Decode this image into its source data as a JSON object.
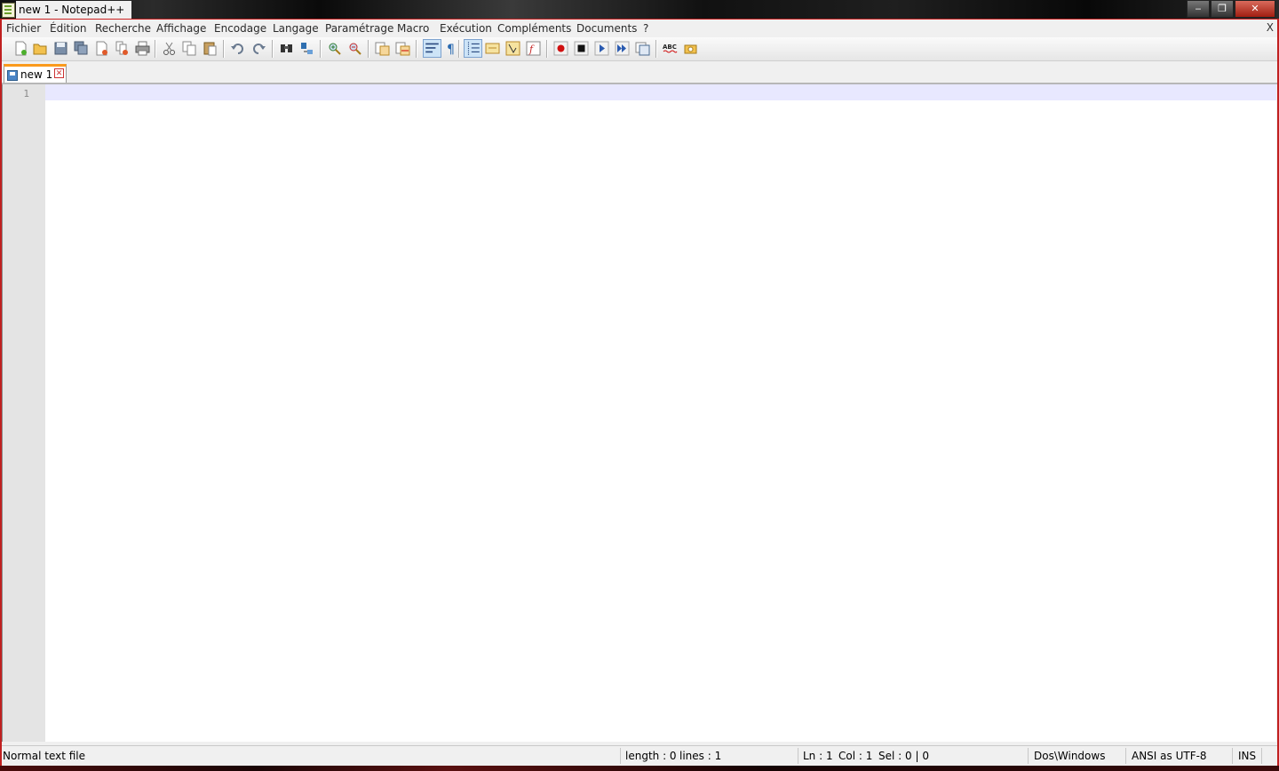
{
  "window": {
    "title": "new  1 - Notepad++",
    "controls": {
      "minimize": "‒",
      "maximize": "❐",
      "close": "✕"
    }
  },
  "menu": {
    "items": [
      "Fichier",
      "Édition",
      "Recherche",
      "Affichage",
      "Encodage",
      "Langage",
      "Paramétrage",
      "Macro",
      "Exécution",
      "Compléments",
      "Documents",
      "?"
    ],
    "close_label": "X"
  },
  "toolbar": {
    "buttons": [
      {
        "name": "new-file",
        "icon": "new-file-icon"
      },
      {
        "name": "open-file",
        "icon": "folder-open-icon"
      },
      {
        "name": "save",
        "icon": "save-icon"
      },
      {
        "name": "save-all",
        "icon": "save-all-icon"
      },
      {
        "name": "close",
        "icon": "close-file-icon"
      },
      {
        "name": "close-all",
        "icon": "close-all-icon"
      },
      {
        "name": "print",
        "icon": "print-icon"
      },
      {
        "name": "cut",
        "icon": "scissors-icon"
      },
      {
        "name": "copy",
        "icon": "copy-icon"
      },
      {
        "name": "paste",
        "icon": "paste-icon"
      },
      {
        "name": "undo",
        "icon": "undo-icon"
      },
      {
        "name": "redo",
        "icon": "redo-icon"
      },
      {
        "name": "find",
        "icon": "binoculars-icon"
      },
      {
        "name": "replace",
        "icon": "replace-icon"
      },
      {
        "name": "zoom-in",
        "icon": "zoom-in-icon"
      },
      {
        "name": "zoom-out",
        "icon": "zoom-out-icon"
      },
      {
        "name": "sync-vertical",
        "icon": "sync-vertical-icon"
      },
      {
        "name": "sync-horizontal",
        "icon": "sync-horizontal-icon"
      },
      {
        "name": "word-wrap",
        "icon": "word-wrap-icon"
      },
      {
        "name": "show-all-chars",
        "icon": "pilcrow-icon"
      },
      {
        "name": "indent-guide",
        "icon": "indent-guide-icon"
      },
      {
        "name": "user-defined-language",
        "icon": "udl-icon"
      },
      {
        "name": "document-map",
        "icon": "document-map-icon"
      },
      {
        "name": "function-list",
        "icon": "function-list-icon"
      },
      {
        "name": "macro-record",
        "icon": "record-icon"
      },
      {
        "name": "macro-stop",
        "icon": "stop-icon"
      },
      {
        "name": "macro-play",
        "icon": "play-icon"
      },
      {
        "name": "macro-run-multiple",
        "icon": "fast-forward-icon"
      },
      {
        "name": "macro-save",
        "icon": "save-macro-icon"
      },
      {
        "name": "spell-check",
        "icon": "spellcheck-icon"
      },
      {
        "name": "plugin",
        "icon": "plugin-icon"
      }
    ],
    "active": [
      "word-wrap",
      "indent-guide"
    ]
  },
  "tabs": [
    {
      "label": "new  1",
      "close": "✕"
    }
  ],
  "editor": {
    "line_numbers": [
      "1"
    ],
    "content": ""
  },
  "statusbar": {
    "file_type": "Normal text file",
    "length": "length : 0",
    "lines": "lines : 1",
    "ln": "Ln : 1",
    "col": "Col : 1",
    "sel": "Sel : 0 | 0",
    "eol": "Dos\\Windows",
    "encoding": "ANSI as UTF-8",
    "mode": "INS"
  },
  "colors": {
    "tab_accent": "#fa9a1c",
    "current_line": "#e8e8ff",
    "gutter": "#e4e4e4"
  }
}
